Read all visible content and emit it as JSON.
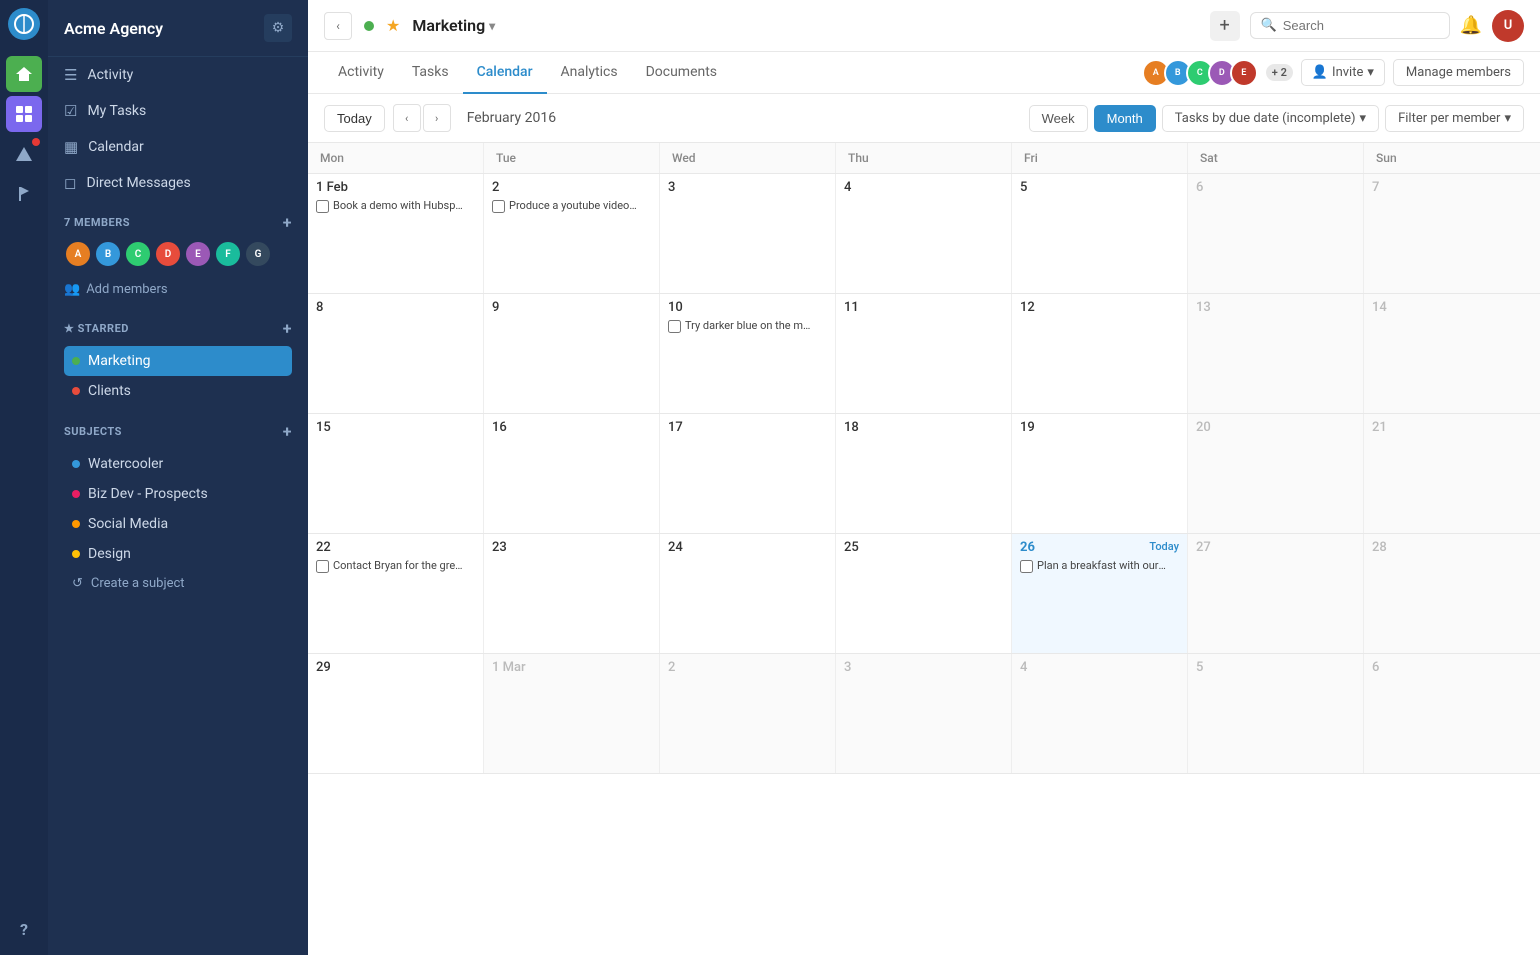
{
  "app": {
    "name": "Acme Agency"
  },
  "icon_sidebar": {
    "icons": [
      {
        "name": "home-icon",
        "symbol": "⌂",
        "active": true
      },
      {
        "name": "grid-icon",
        "symbol": "▦",
        "active": false,
        "color": "green"
      },
      {
        "name": "triangle-icon",
        "symbol": "▲",
        "active": false,
        "color": "purple"
      },
      {
        "name": "flag-icon",
        "symbol": "⚑",
        "active": false,
        "badge": true
      },
      {
        "name": "layers-icon",
        "symbol": "◈",
        "active": false
      }
    ],
    "bottom": "?"
  },
  "sidebar": {
    "header": {
      "title": "Acme Agency",
      "gear_label": "⚙"
    },
    "nav": [
      {
        "label": "Activity",
        "icon": "☰",
        "name": "activity-nav"
      },
      {
        "label": "My Tasks",
        "icon": "☑",
        "name": "my-tasks-nav"
      },
      {
        "label": "Calendar",
        "icon": "📅",
        "name": "calendar-nav"
      },
      {
        "label": "Direct Messages",
        "icon": "💬",
        "name": "direct-messages-nav"
      }
    ],
    "members": {
      "label": "7 MEMBERS",
      "add_icon": "+",
      "avatars": [
        {
          "initials": "A",
          "color": "#e67e22"
        },
        {
          "initials": "B",
          "color": "#3498db"
        },
        {
          "initials": "C",
          "color": "#2ecc71"
        },
        {
          "initials": "D",
          "color": "#e74c3c"
        },
        {
          "initials": "E",
          "color": "#9b59b6"
        },
        {
          "initials": "F",
          "color": "#1abc9c"
        },
        {
          "initials": "G",
          "color": "#34495e"
        }
      ],
      "add_label": "Add members"
    },
    "starred": {
      "label": "★ STARRED",
      "add_icon": "+",
      "items": [
        {
          "label": "Marketing",
          "dot_color": "#4caf50",
          "active": true
        },
        {
          "label": "Clients",
          "dot_color": "#e74c3c",
          "active": false
        }
      ]
    },
    "subjects": {
      "label": "SUBJECTS",
      "add_icon": "+",
      "items": [
        {
          "label": "Watercooler",
          "dot_color": "#3498db"
        },
        {
          "label": "Biz Dev - Prospects",
          "dot_color": "#e91e63"
        },
        {
          "label": "Social Media",
          "dot_color": "#ff9800"
        },
        {
          "label": "Design",
          "dot_color": "#ffc107"
        }
      ],
      "create_label": "Create a subject"
    }
  },
  "topbar": {
    "project_name": "Marketing",
    "project_chevron": "▾",
    "add_icon": "+",
    "search_placeholder": "Search",
    "bell_icon": "🔔"
  },
  "tabs": {
    "items": [
      {
        "label": "Activity",
        "active": false
      },
      {
        "label": "Tasks",
        "active": false
      },
      {
        "label": "Calendar",
        "active": true
      },
      {
        "label": "Analytics",
        "active": false
      },
      {
        "label": "Documents",
        "active": false
      }
    ],
    "plus_badge": "+ 2",
    "invite_label": "Invite",
    "invite_chevron": "▾",
    "manage_label": "Manage members"
  },
  "calendar": {
    "today_label": "Today",
    "prev_icon": "‹",
    "next_icon": "›",
    "month_label": "February 2016",
    "week_label": "Week",
    "month_btn": "Month",
    "tasks_filter": "Tasks by due date (incomplete)",
    "filter_member": "Filter per member",
    "day_headers": [
      "Mon",
      "Tue",
      "Wed",
      "Thu",
      "Fri",
      "Sat",
      "Sun"
    ],
    "weeks": [
      {
        "days": [
          {
            "date": "1 Feb",
            "tasks": [
              {
                "text": "Book a demo with Hubspot"
              }
            ],
            "other": false,
            "today": false
          },
          {
            "date": "2",
            "tasks": [
              {
                "text": "Produce a youtube video for"
              }
            ],
            "other": false,
            "today": false
          },
          {
            "date": "3",
            "tasks": [],
            "other": false,
            "today": false
          },
          {
            "date": "4",
            "tasks": [],
            "other": false,
            "today": false
          },
          {
            "date": "5",
            "tasks": [],
            "other": false,
            "today": false
          },
          {
            "date": "6",
            "tasks": [],
            "other": false,
            "today": false
          },
          {
            "date": "7",
            "tasks": [],
            "other": false,
            "today": false
          }
        ]
      },
      {
        "days": [
          {
            "date": "8",
            "tasks": [],
            "other": false,
            "today": false
          },
          {
            "date": "9",
            "tasks": [],
            "other": false,
            "today": false
          },
          {
            "date": "10",
            "tasks": [
              {
                "text": "Try darker blue on the mobil"
              }
            ],
            "other": false,
            "today": false
          },
          {
            "date": "11",
            "tasks": [],
            "other": false,
            "today": false
          },
          {
            "date": "12",
            "tasks": [],
            "other": false,
            "today": false
          },
          {
            "date": "13",
            "tasks": [],
            "other": false,
            "today": false
          },
          {
            "date": "14",
            "tasks": [],
            "other": false,
            "today": false
          }
        ]
      },
      {
        "days": [
          {
            "date": "15",
            "tasks": [],
            "other": false,
            "today": false
          },
          {
            "date": "16",
            "tasks": [],
            "other": false,
            "today": false
          },
          {
            "date": "17",
            "tasks": [],
            "other": false,
            "today": false
          },
          {
            "date": "18",
            "tasks": [],
            "other": false,
            "today": false
          },
          {
            "date": "19",
            "tasks": [],
            "other": false,
            "today": false
          },
          {
            "date": "20",
            "tasks": [],
            "other": false,
            "today": false
          },
          {
            "date": "21",
            "tasks": [],
            "other": false,
            "today": false
          }
        ]
      },
      {
        "days": [
          {
            "date": "22",
            "tasks": [
              {
                "text": "Contact Bryan for the greeti"
              }
            ],
            "other": false,
            "today": false
          },
          {
            "date": "23",
            "tasks": [],
            "other": false,
            "today": false
          },
          {
            "date": "24",
            "tasks": [],
            "other": false,
            "today": false
          },
          {
            "date": "25",
            "tasks": [],
            "other": false,
            "today": false
          },
          {
            "date": "26",
            "tasks": [
              {
                "text": "Plan a breakfast with our pa"
              }
            ],
            "other": false,
            "today": true,
            "today_label": "Today"
          },
          {
            "date": "27",
            "tasks": [],
            "other": false,
            "today": false
          },
          {
            "date": "28",
            "tasks": [],
            "other": false,
            "today": false
          }
        ]
      },
      {
        "days": [
          {
            "date": "29",
            "tasks": [],
            "other": false,
            "today": false
          },
          {
            "date": "1 Mar",
            "tasks": [],
            "other": true,
            "today": false
          },
          {
            "date": "2",
            "tasks": [],
            "other": true,
            "today": false
          },
          {
            "date": "3",
            "tasks": [],
            "other": true,
            "today": false
          },
          {
            "date": "4",
            "tasks": [],
            "other": true,
            "today": false
          },
          {
            "date": "5",
            "tasks": [],
            "other": true,
            "today": false
          },
          {
            "date": "6",
            "tasks": [],
            "other": true,
            "today": false
          }
        ]
      }
    ]
  }
}
